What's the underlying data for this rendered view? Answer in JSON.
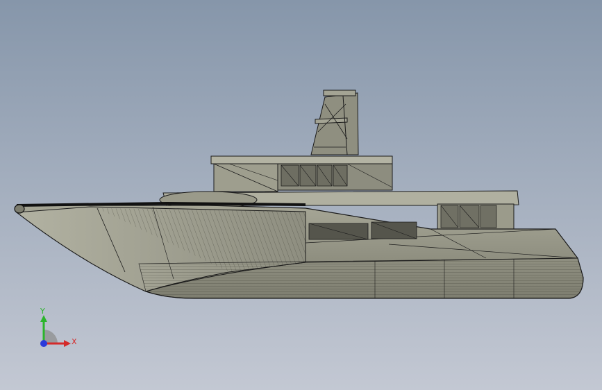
{
  "viewport": {
    "background_top": "#8696aa",
    "background_bottom": "#c3c8d3"
  },
  "model": {
    "name": "",
    "hull_color": "#9a9a8a",
    "hull_shadow_color": "#6f6f62",
    "edge_color": "#1a1a1a",
    "display_mode": "shaded-with-edges"
  },
  "triad": {
    "x_label": "X",
    "y_label": "Y",
    "x_color": "#d42a2a",
    "y_color": "#2bb52b",
    "z_color": "#2a3adb"
  }
}
